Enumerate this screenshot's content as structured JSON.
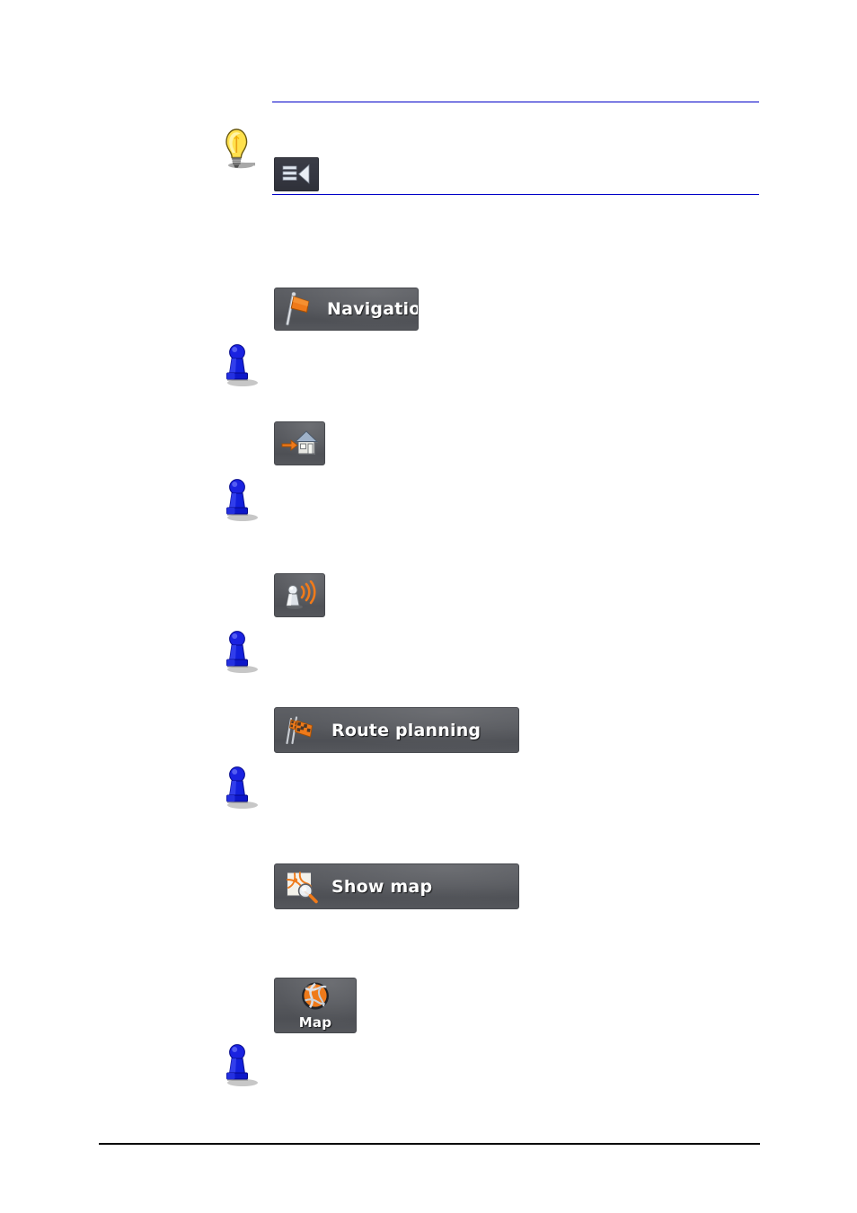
{
  "document": {
    "type": "manual-page",
    "background_color": "#ffffff",
    "rules": {
      "blue_color": "#0000c8",
      "black_color": "#000000"
    }
  },
  "tip_section": {
    "icon": "lightbulb-icon",
    "menu_button": {
      "icon": "menu-list-back-icon",
      "label": ""
    }
  },
  "markers": [
    {
      "icon": "blue-pawn-marker-icon"
    },
    {
      "icon": "blue-pawn-marker-icon"
    },
    {
      "icon": "blue-pawn-marker-icon"
    },
    {
      "icon": "blue-pawn-marker-icon"
    },
    {
      "icon": "blue-pawn-marker-icon"
    }
  ],
  "buttons": {
    "navigation": {
      "label": "Navigation",
      "icon": "orange-flag-icon"
    },
    "home": {
      "label": "",
      "icon": "go-home-arrow-house-icon"
    },
    "gps_status": {
      "label": "",
      "icon": "gps-signal-icon"
    },
    "route_planning": {
      "label": "Route planning",
      "icon": "checkered-flags-icon"
    },
    "show_map": {
      "label": "Show map",
      "icon": "map-magnifier-icon"
    },
    "map": {
      "label": "Map",
      "icon": "orange-globe-icon"
    }
  },
  "colors": {
    "button_face": "#55575c",
    "button_border": "#46484d",
    "accent_orange": "#e8731a",
    "pawn_blue": "#0b17d8",
    "bulb_yellow": "#ffd92b",
    "label_white": "#ffffff"
  }
}
